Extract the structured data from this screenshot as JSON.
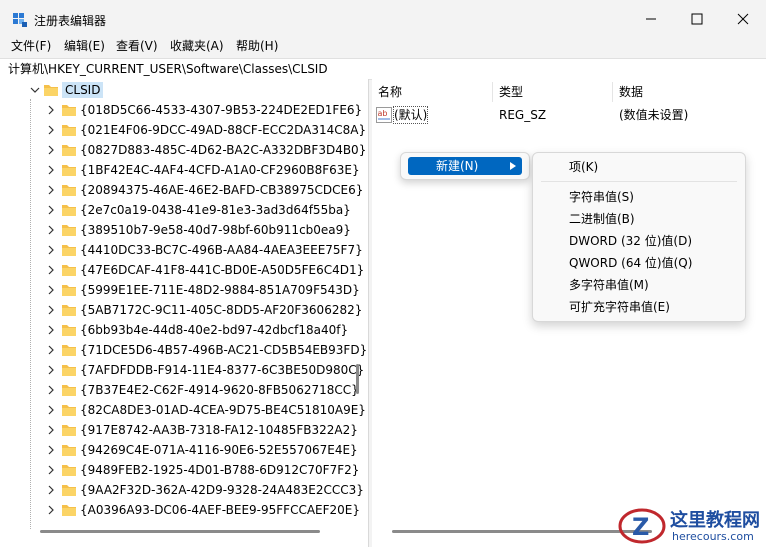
{
  "window": {
    "title": "注册表编辑器"
  },
  "menu": [
    "文件(F)",
    "编辑(E)",
    "查看(V)",
    "收藏夹(A)",
    "帮助(H)"
  ],
  "address": "计算机\\HKEY_CURRENT_USER\\Software\\Classes\\CLSID",
  "tree": {
    "root": "CLSID",
    "items": [
      "{018D5C66-4533-4307-9B53-224DE2ED1FE6}",
      "{021E4F06-9DCC-49AD-88CF-ECC2DA314C8A}",
      "{0827D883-485C-4D62-BA2C-A332DBF3D4B0}",
      "{1BF42E4C-4AF4-4CFD-A1A0-CF2960B8F63E}",
      "{20894375-46AE-46E2-BAFD-CB38975CDCE6}",
      "{2e7c0a19-0438-41e9-81e3-3ad3d64f55ba}",
      "{389510b7-9e58-40d7-98bf-60b911cb0ea9}",
      "{4410DC33-BC7C-496B-AA84-4AEA3EEE75F7}",
      "{47E6DCAF-41F8-441C-BD0E-A50D5FE6C4D1}",
      "{5999E1EE-711E-48D2-9884-851A709F543D}",
      "{5AB7172C-9C11-405C-8DD5-AF20F3606282}",
      "{6bb93b4e-44d8-40e2-bd97-42dbcf18a40f}",
      "{71DCE5D6-4B57-496B-AC21-CD5B54EB93FD}",
      "{7AFDFDDB-F914-11E4-8377-6C3BE50D980C}",
      "{7B37E4E2-C62F-4914-9620-8FB5062718CC}",
      "{82CA8DE3-01AD-4CEA-9D75-BE4C51810A9E}",
      "{917E8742-AA3B-7318-FA12-10485FB322A2}",
      "{94269C4E-071A-4116-90E6-52E557067E4E}",
      "{9489FEB2-1925-4D01-B788-6D912C70F7F2}",
      "{9AA2F32D-362A-42D9-9328-24A483E2CCC3}",
      "{A0396A93-DC06-4AEF-BEE9-95FFCCAEF20E}"
    ]
  },
  "values": {
    "headers": {
      "name": "名称",
      "type": "类型",
      "data": "数据"
    },
    "rows": [
      {
        "name": "(默认)",
        "type": "REG_SZ",
        "data": "(数值未设置)"
      }
    ]
  },
  "context_menu": {
    "new_label": "新建(N)"
  },
  "submenu": {
    "key": "项(K)",
    "items": [
      "字符串值(S)",
      "二进制值(B)",
      "DWORD (32 位)值(D)",
      "QWORD (64 位)值(Q)",
      "多字符串值(M)",
      "可扩充字符串值(E)"
    ]
  },
  "watermark": {
    "text": "这里教程网",
    "url": "herecours.com"
  },
  "colors": {
    "accent": "#0067c0",
    "folder": "#f5c04a"
  }
}
